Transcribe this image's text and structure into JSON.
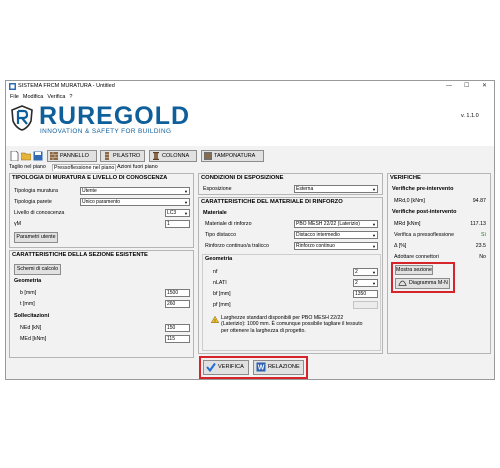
{
  "window": {
    "title": "SISTEMA FRCM MURATURA - Untitled",
    "controls": {
      "minimize": "—",
      "maximize": "☐",
      "close": "✕"
    }
  },
  "menu": [
    "File",
    "Modifica",
    "Verifica",
    "?"
  ],
  "brand": {
    "logo_text": "RUREGOLD",
    "tagline": "INNOVATION & SAFETY FOR BUILDING",
    "version": "v. 1.1.0",
    "colors": {
      "primary": "#0f5f9a",
      "dark": "#2b2b2b"
    }
  },
  "toolbar": {
    "icons": [
      "document-icon",
      "folder-icon",
      "save-icon"
    ],
    "buttons": [
      {
        "label": "PANNELLO",
        "icon": "panel-icon"
      },
      {
        "label": "PILASTRO",
        "icon": "pillar-icon"
      },
      {
        "label": "COLONNA",
        "icon": "column-icon"
      },
      {
        "label": "TAMPONATURA",
        "icon": "infill-icon"
      }
    ]
  },
  "tabs": [
    {
      "label": "Taglio nel piano",
      "active": false
    },
    {
      "label": "Pressoflessione nel piano",
      "active": true
    },
    {
      "label": "Azioni fuori piano",
      "active": false
    }
  ],
  "tipologia": {
    "title": "TIPOLOGIA DI MURATURA E LIVELLO DI CONOSCENZA",
    "fields": [
      {
        "label": "Tipologia muratura",
        "value": "Utente"
      },
      {
        "label": "Tipologia parete",
        "value": "Unico paramento"
      },
      {
        "label": "Livello di conoscenza",
        "value": "LC3"
      },
      {
        "label": "γM",
        "value": "1"
      }
    ],
    "button": "Parametri utente"
  },
  "sezione": {
    "title": "CARATTERISTICHE DELLA SEZIONE ESISTENTE",
    "button": "Schemi di calcolo",
    "geometria": {
      "title": "Geometria",
      "b_label": "b [mm]",
      "b_value": "1500",
      "t_label": "t [mm]",
      "t_value": "260"
    },
    "sollecitazioni": {
      "title": "Sollecitazioni",
      "ned_label": "NEd [kN]",
      "ned_value": "150",
      "med_label": "MEd [kNm]",
      "med_value": "115"
    }
  },
  "esposizione": {
    "title": "CONDIZIONI DI ESPOSIZIONE",
    "label": "Esposizione",
    "value": "Esterna"
  },
  "rinforzo": {
    "title": "CARATTERISTICHE DEL MATERIALE DI RINFORZO",
    "materiale": {
      "title": "Materiale",
      "fields": [
        {
          "label": "Materiale di rinforzo",
          "value": "PBO MESH 22/22 (Laterizio)"
        },
        {
          "label": "Tipo distacco",
          "value": "Distacco intermedio"
        },
        {
          "label": "Rinforzo continuo/a tralicco",
          "value": "Rinforzo continuo"
        }
      ]
    },
    "geometria": {
      "title": "Geometria",
      "nf_label": "nf",
      "nf_value": "2",
      "nlati_label": "nLATI",
      "nlati_value": "2",
      "bf_label": "bf [mm]",
      "bf_value": "1350",
      "pf_label": "pf [mm]",
      "pf_value": ""
    },
    "warning": "Larghezze standard disponibili per PBO MESH 22/22 (Laterizio): 1000 mm. È comunque possibile tagliare il tessuto per ottenere la larghezza di progetto."
  },
  "verifiche": {
    "title": "VERIFICHE",
    "pre_title": "Verifiche pre-intervento",
    "pre": [
      {
        "label": "MRd,0 [kNm]",
        "value": "94.87"
      }
    ],
    "post_title": "Verifiche post-intervento",
    "post": [
      {
        "label": "MRd [kNm]",
        "value": "117.13"
      },
      {
        "label": "Verifica a pressoflessione",
        "value": "Sì"
      },
      {
        "label": "Δ [%]",
        "value": "23.5"
      },
      {
        "label": "Adottare connettori",
        "value": "No"
      }
    ],
    "mostra_button": "Mostra sezione",
    "diagramma_button": "Diagramma M-N"
  },
  "actions": {
    "verifica": "VERIFICA",
    "relazione": "RELAZIONE"
  },
  "highlight_color": "#d6252a"
}
